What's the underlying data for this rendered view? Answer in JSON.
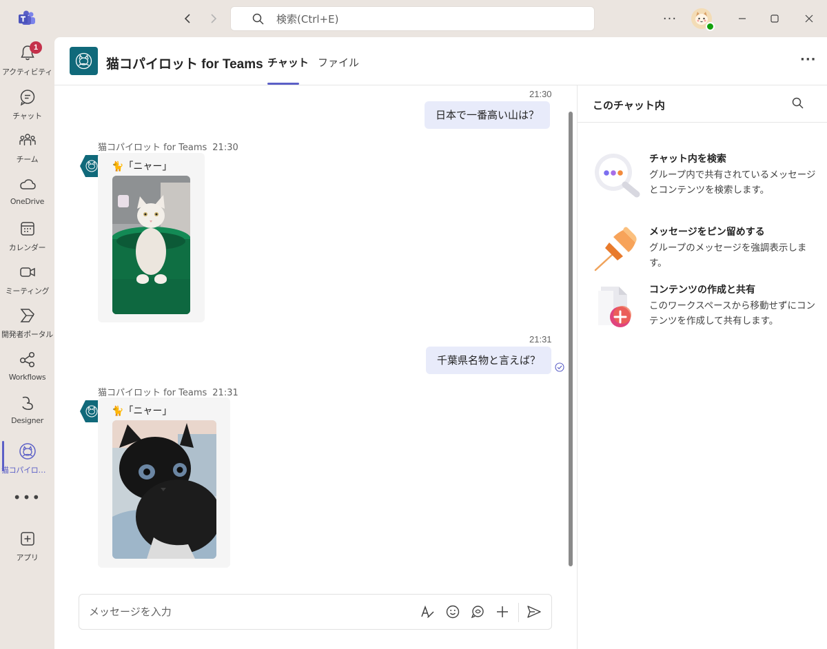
{
  "app": {
    "name": "Microsoft Teams"
  },
  "titlebar": {
    "search_placeholder": "検索(Ctrl+E)",
    "more": "···"
  },
  "rail": {
    "activity_badge": "1",
    "items": [
      {
        "label": "アクティビティ",
        "icon": "bell-icon"
      },
      {
        "label": "チャット",
        "icon": "chat-icon"
      },
      {
        "label": "チーム",
        "icon": "teams-icon"
      },
      {
        "label": "OneDrive",
        "icon": "cloud-icon"
      },
      {
        "label": "カレンダー",
        "icon": "calendar-icon"
      },
      {
        "label": "ミーティング",
        "icon": "video-icon"
      },
      {
        "label": "開発者ポータル",
        "icon": "developer-portal-icon"
      },
      {
        "label": "Workflows",
        "icon": "workflows-icon"
      },
      {
        "label": "Designer",
        "icon": "designer-icon"
      },
      {
        "label": "猫コパイロット for Teams",
        "icon": "cat-copilot-icon",
        "active": true
      }
    ],
    "more": "•••",
    "apps_label": "アプリ"
  },
  "header": {
    "title": "猫コパイロット for Teams",
    "tabs": [
      {
        "label": "チャット",
        "active": true
      },
      {
        "label": "ファイル",
        "active": false
      }
    ],
    "more": "···"
  },
  "chat": {
    "messages": [
      {
        "from": "me",
        "time": "21:30",
        "text": "日本で一番高い山は？"
      },
      {
        "from": "bot",
        "sender": "猫コパイロット for Teams",
        "time": "21:30",
        "text": "🐈「ニャー」",
        "image": "white-cat-photo"
      },
      {
        "from": "me",
        "time": "21:31",
        "text": "千葉県名物と言えば？"
      },
      {
        "from": "bot",
        "sender": "猫コパイロット for Teams",
        "time": "21:31",
        "text": "🐈「ニャー」",
        "image": "black-cat-photo"
      }
    ],
    "compose_placeholder": "メッセージを入力"
  },
  "side_panel": {
    "title": "このチャット内",
    "features": [
      {
        "title": "チャット内を検索",
        "desc": "グループ内で共有されているメッセージとコンテンツを検索します。",
        "icon": "magnifier-dots-icon"
      },
      {
        "title": "メッセージをピン留めする",
        "desc": "グループのメッセージを強調表示します。",
        "icon": "pushpin-icon"
      },
      {
        "title": "コンテンツの作成と共有",
        "desc": "このワークスペースから移動せずにコンテンツを作成して共有します。",
        "icon": "document-add-icon"
      }
    ]
  },
  "colors": {
    "accent": "#5b5fc7",
    "bubble_me": "#e8ebfa",
    "bot_card": "#f5f5f5",
    "app_icon_bg": "#10697a",
    "presence_available": "#13a10e",
    "badge": "#c4314b"
  }
}
